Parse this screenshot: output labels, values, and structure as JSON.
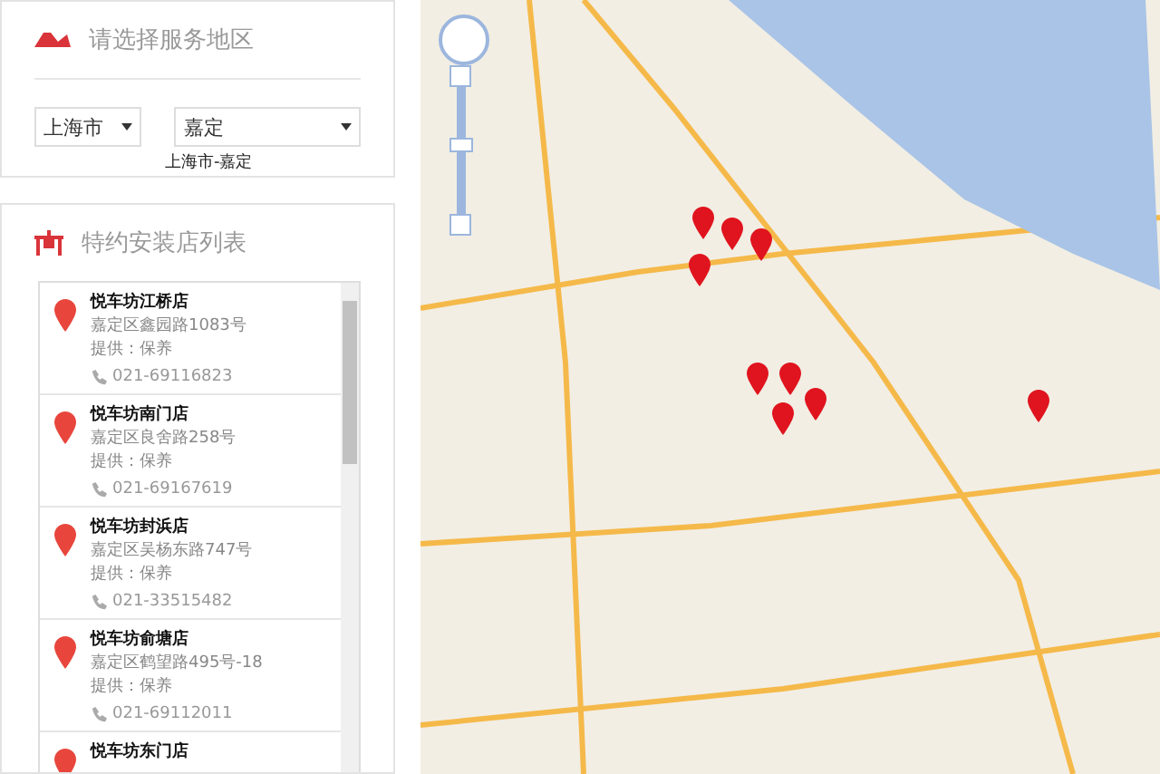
{
  "region_panel": {
    "title": "请选择服务地区",
    "province": {
      "value": "上海市"
    },
    "district": {
      "value": "嘉定"
    },
    "selection": "上海市-嘉定"
  },
  "store_panel": {
    "title": "特约安装店列表",
    "stores": [
      {
        "name": "悦车坊江桥店",
        "address": "嘉定区鑫园路1083号",
        "service": "提供：保养",
        "phone": "021-69116823"
      },
      {
        "name": "悦车坊南门店",
        "address": "嘉定区良舍路258号",
        "service": "提供：保养",
        "phone": "021-69167619"
      },
      {
        "name": "悦车坊封浜店",
        "address": "嘉定区吴杨东路747号",
        "service": "提供：保养",
        "phone": "021-33515482"
      },
      {
        "name": "悦车坊俞塘店",
        "address": "嘉定区鹤望路495号-18",
        "service": "提供：保养",
        "phone": "021-69112011"
      },
      {
        "name": "悦车坊东门店"
      }
    ]
  },
  "map": {
    "zoom": {
      "level": 0.55
    }
  }
}
